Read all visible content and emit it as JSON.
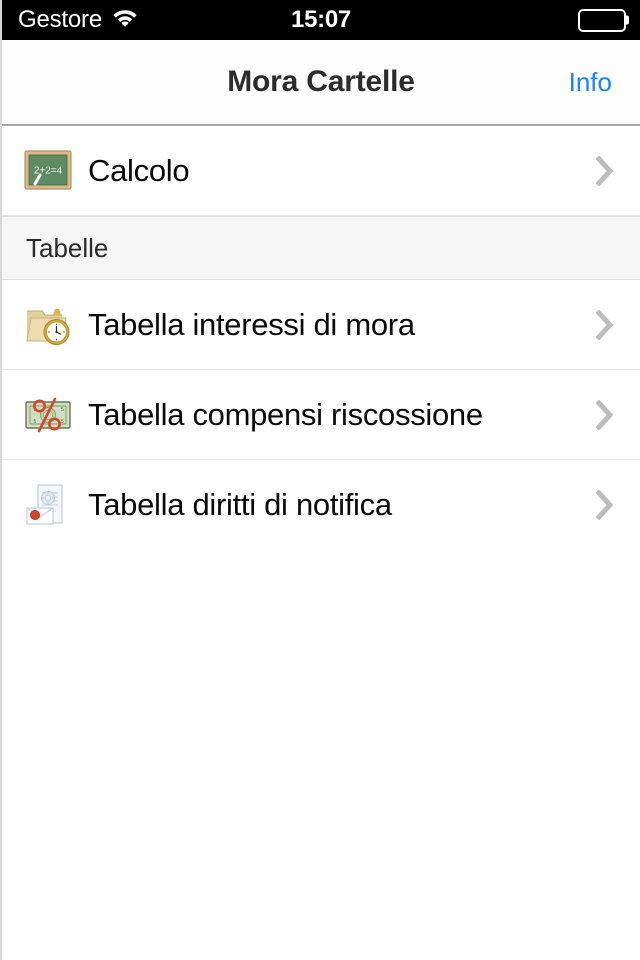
{
  "status_bar": {
    "carrier": "Gestore",
    "wifi_icon": "wifi-icon",
    "time": "15:07",
    "battery_icon": "battery-full-icon"
  },
  "nav_bar": {
    "title": "Mora Cartelle",
    "right_button": "Info",
    "accent_color": "#1982ff"
  },
  "list": {
    "top_rows": [
      {
        "label": "Calcolo",
        "icon": "chalkboard-icon",
        "icon_text": "2+2=4",
        "accessory": "chevron-right-icon"
      }
    ],
    "section_header": "Tabelle",
    "section_rows": [
      {
        "label": "Tabella interessi di mora",
        "icon": "folder-clock-icon",
        "accessory": "chevron-right-icon"
      },
      {
        "label": "Tabella compensi riscossione",
        "icon": "banknote-percent-icon",
        "accessory": "chevron-right-icon"
      },
      {
        "label": "Tabella diritti di notifica",
        "icon": "document-envelope-icon",
        "accessory": "chevron-right-icon"
      }
    ]
  }
}
